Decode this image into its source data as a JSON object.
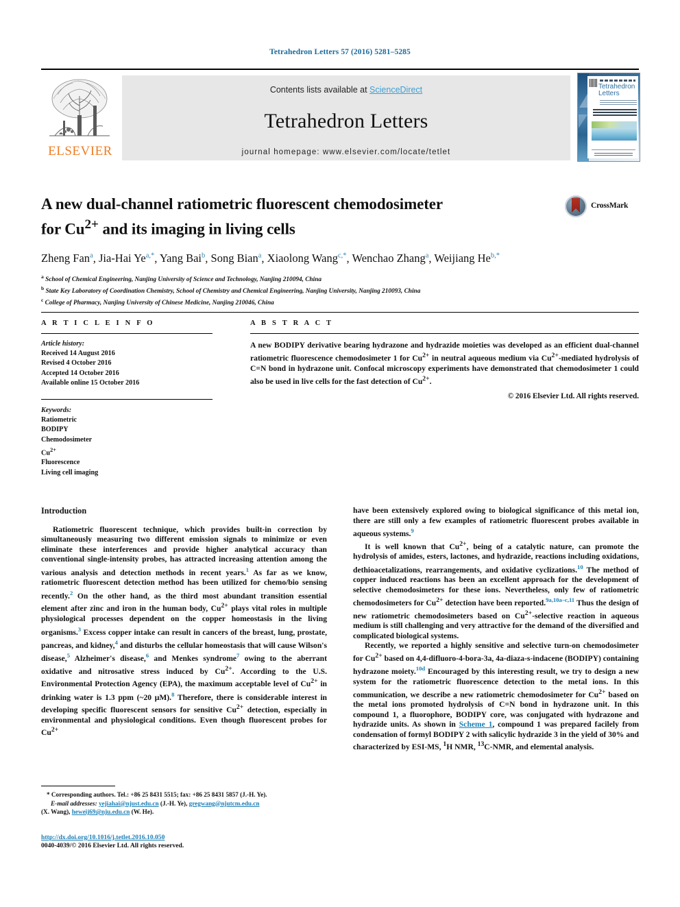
{
  "running_head": "Tetrahedron Letters 57 (2016) 5281–5285",
  "masthead": {
    "contents_prefix": "Contents lists available at ",
    "sciencedirect": "ScienceDirect",
    "journal_title": "Tetrahedron Letters",
    "homepage": "journal homepage: www.elsevier.com/locate/tetlet",
    "publisher_logo_text": "ELSEVIER",
    "cover_title_line1": "Tetrahedron",
    "cover_title_line2": "Letters"
  },
  "article": {
    "title": "A new dual-channel ratiometric fluorescent chemodosimeter for Cu2+ and its imaging in living cells",
    "title_line1_a": "A new dual-channel ratiometric fluorescent chemodosimeter",
    "title_line2_a": "for Cu",
    "title_line2_sup": "2+",
    "title_line2_b": " and its imaging in living cells",
    "crossmark_label": "CrossMark",
    "authors": [
      {
        "name": "Zheng Fan",
        "marks": "a"
      },
      {
        "name": "Jia-Hai Ye",
        "marks": "a,*"
      },
      {
        "name": "Yang Bai",
        "marks": "b"
      },
      {
        "name": "Song Bian",
        "marks": "a"
      },
      {
        "name": "Xiaolong Wang",
        "marks": "c,*"
      },
      {
        "name": "Wenchao Zhang",
        "marks": "a"
      },
      {
        "name": "Weijiang He",
        "marks": "b,*"
      }
    ],
    "affiliations": [
      {
        "mark": "a",
        "text": "School of Chemical Engineering, Nanjing University of Science and Technology, Nanjing 210094, China"
      },
      {
        "mark": "b",
        "text": "State Key Laboratory of Coordination Chemistry, School of Chemistry and Chemical Engineering, Nanjing University, Nanjing 210093, China"
      },
      {
        "mark": "c",
        "text": "College of Pharmacy, Nanjing University of Chinese Medicine, Nanjing 210046, China"
      }
    ]
  },
  "article_info": {
    "heading": "A R T I C L E   I N F O",
    "history_label": "Article history:",
    "history": [
      "Received 14 August 2016",
      "Revised 4 October 2016",
      "Accepted 14 October 2016",
      "Available online 15 October 2016"
    ],
    "keywords_label": "Keywords:",
    "keywords": [
      "Ratiometric",
      "BODIPY",
      "Chemodosimeter",
      "Cu2+",
      "Fluorescence",
      "Living cell imaging"
    ]
  },
  "abstract": {
    "heading": "A B S T R A C T",
    "text": "A new BODIPY derivative bearing hydrazone and hydrazide moieties was developed as an efficient dual-channel ratiometric fluorescence chemodosimeter 1 for Cu2+ in neutral aqueous medium via Cu2+-mediated hydrolysis of C=N bond in hydrazone unit. Confocal microscopy experiments have demonstrated that chemodosimeter 1 could also be used in live cells for the fast detection of Cu2+.",
    "copyright": "© 2016 Elsevier Ltd. All rights reserved."
  },
  "body": {
    "section_title": "Introduction",
    "left_paragraphs": [
      "Ratiometric fluorescent technique, which provides built-in correction by simultaneously measuring two different emission signals to minimize or even eliminate these interferences and provide higher analytical accuracy than conventional single-intensity probes, has attracted increasing attention among the various analysis and detection methods in recent years.1 As far as we know, ratiometric fluorescent detection method has been utilized for chemo/bio sensing recently.2 On the other hand, as the third most abundant transition essential element after zinc and iron in the human body, Cu2+ plays vital roles in multiple physiological processes dependent on the copper homeostasis in the living organisms.3 Excess copper intake can result in cancers of the breast, lung, prostate, pancreas, and kidney,4 and disturbs the cellular homeostasis that will cause Wilson's disease,5 Alzheimer's disease,6 and Menkes syndrome7 owing to the aberrant oxidative and nitrosative stress induced by Cu2+. According to the U.S. Environmental Protection Agency (EPA), the maximum acceptable level of Cu2+ in drinking water is 1.3 ppm (~20 μM).8 Therefore, there is considerable interest in developing specific fluorescent sensors for sensitive Cu2+ detection, especially in environmental and physiological conditions. Even though fluorescent probes for Cu2+"
    ],
    "right_paragraphs": [
      "have been extensively explored owing to biological significance of this metal ion, there are still only a few examples of ratiometric fluorescent probes available in aqueous systems.9",
      "It is well known that Cu2+, being of a catalytic nature, can promote the hydrolysis of amides, esters, lactones, and hydrazide, reactions including oxidations, dethioacetalizations, rearrangements, and oxidative cyclizations.10 The method of copper induced reactions has been an excellent approach for the development of selective chemodosimeters for these ions. Nevertheless, only few of ratiometric chemodosimeters for Cu2+ detection have been reported.9a,10a–c,11 Thus the design of new ratiometric chemodosimeters based on Cu2+-selective reaction in aqueous medium is still challenging and very attractive for the demand of the diversified and complicated biological systems.",
      "Recently, we reported a highly sensitive and selective turn-on chemodosimeter for Cu2+ based on 4,4-difluoro-4-bora-3a, 4a-diaza-s-indacene (BODIPY) containing hydrazone moiety.10d Encouraged by this interesting result, we try to design a new system for the ratiometric fluorescence detection to the metal ions. In this communication, we describe a new ratiometric chemodosimeter for Cu2+ based on the metal ions promoted hydrolysis of C=N bond in hydrazone unit. In this compound 1, a fluorophore, BODIPY core, was conjugated with hydrazone and hydrazide units. As shown in Scheme 1, compound 1 was prepared facilely from condensation of formyl BODIPY 2 with salicylic hydrazide 3 in the yield of 30% and characterized by ESI-MS, 1H NMR, 13C-NMR, and elemental analysis."
    ],
    "scheme_link_text": "Scheme"
  },
  "footnote": {
    "star": "*",
    "corresponding": "Corresponding authors. Tel.: +86 25 8431 5515; fax: +86 25 8431 5857 (J.-H. Ye).",
    "email_label": "E-mail addresses:",
    "emails": [
      {
        "addr": "yejiahai@njust.edu.cn",
        "who": "(J.-H. Ye)"
      },
      {
        "addr": "gregwang@njutcm.edu.cn",
        "who": "(X. Wang)"
      },
      {
        "addr": "heweij69@nju.edu.cn",
        "who": "(W. He)"
      }
    ]
  },
  "bottom": {
    "doi": "http://dx.doi.org/10.1016/j.tetlet.2016.10.050",
    "issn_line": "0040-4039/© 2016 Elsevier Ltd. All rights reserved."
  },
  "colors": {
    "link_blue": "#1b7eb5",
    "sciencedirect_blue": "#3c9fd4",
    "elsevier_orange": "#ef7d22",
    "band_gray": "#e7e7e7"
  }
}
